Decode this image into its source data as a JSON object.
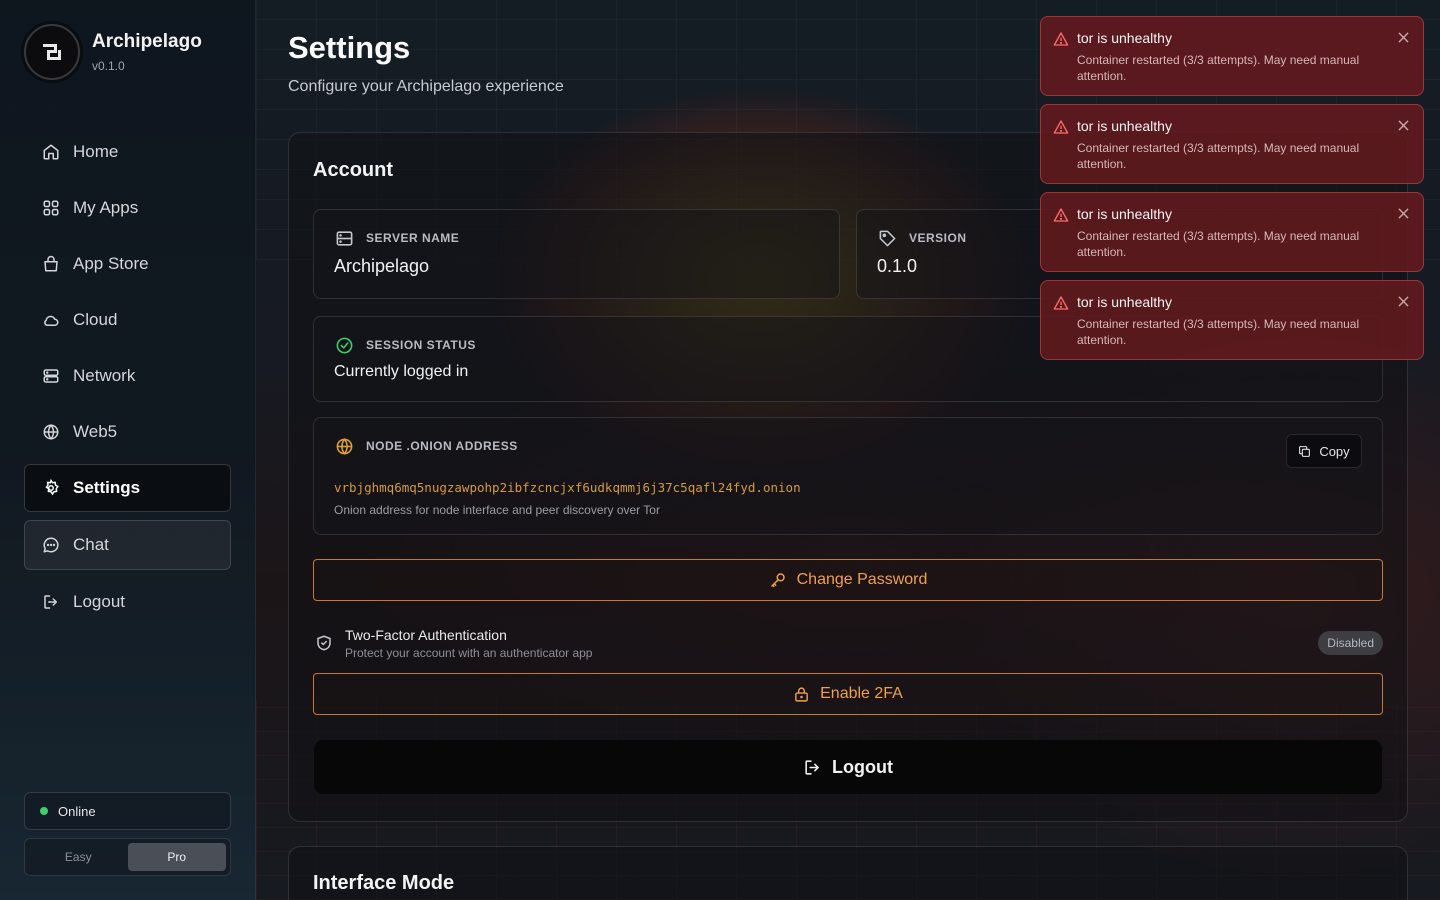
{
  "colors": {
    "accent": "#f0a04a",
    "accent_border": "#c77a2a",
    "online": "#3ecf6a",
    "onion_text": "#d49a3e",
    "toast_bg": "#601a1e",
    "toast_icon": "#ff6b6b"
  },
  "brand": {
    "name": "Archipelago",
    "version": "v0.1.0",
    "icon": "archipelago-logo-icon"
  },
  "sidebar": {
    "items": [
      {
        "label": "Home",
        "icon": "home-icon"
      },
      {
        "label": "My Apps",
        "icon": "grid-icon"
      },
      {
        "label": "App Store",
        "icon": "shopping-bag-icon"
      },
      {
        "label": "Cloud",
        "icon": "cloud-icon"
      },
      {
        "label": "Network",
        "icon": "server-icon"
      },
      {
        "label": "Web5",
        "icon": "globe-icon"
      },
      {
        "label": "Settings",
        "icon": "gear-icon",
        "active": true
      },
      {
        "label": "Chat",
        "icon": "chat-icon"
      },
      {
        "label": "Logout",
        "icon": "logout-icon"
      }
    ],
    "status": "Online",
    "mode": {
      "options": [
        "Easy",
        "Pro"
      ],
      "selected": "Pro"
    }
  },
  "header": {
    "title": "Settings",
    "subtitle": "Configure your Archipelago experience"
  },
  "account": {
    "title": "Account",
    "server_name": {
      "label": "SERVER NAME",
      "value": "Archipelago"
    },
    "version": {
      "label": "VERSION",
      "value": "0.1.0"
    },
    "session": {
      "label": "SESSION STATUS",
      "value": "Currently logged in"
    },
    "onion": {
      "label": "NODE .ONION ADDRESS",
      "address": "vrbjghmq6mq5nugzawpohp2ibfzcncjxf6udkqmmj6j37c5qafl24fyd.onion",
      "description": "Onion address for node interface and peer discovery over Tor",
      "copy_label": "Copy"
    },
    "change_password_label": "Change Password",
    "two_factor": {
      "title": "Two-Factor Authentication",
      "subtitle": "Protect your account with an authenticator app",
      "badge": "Disabled",
      "button_label": "Enable 2FA"
    },
    "logout_label": "Logout"
  },
  "interface_mode": {
    "title": "Interface Mode"
  },
  "toasts": [
    {
      "title": "tor is unhealthy",
      "message": "Container restarted (3/3 attempts). May need manual attention."
    },
    {
      "title": "tor is unhealthy",
      "message": "Container restarted (3/3 attempts). May need manual attention."
    },
    {
      "title": "tor is unhealthy",
      "message": "Container restarted (3/3 attempts). May need manual attention."
    },
    {
      "title": "tor is unhealthy",
      "message": "Container restarted (3/3 attempts). May need manual attention."
    }
  ]
}
